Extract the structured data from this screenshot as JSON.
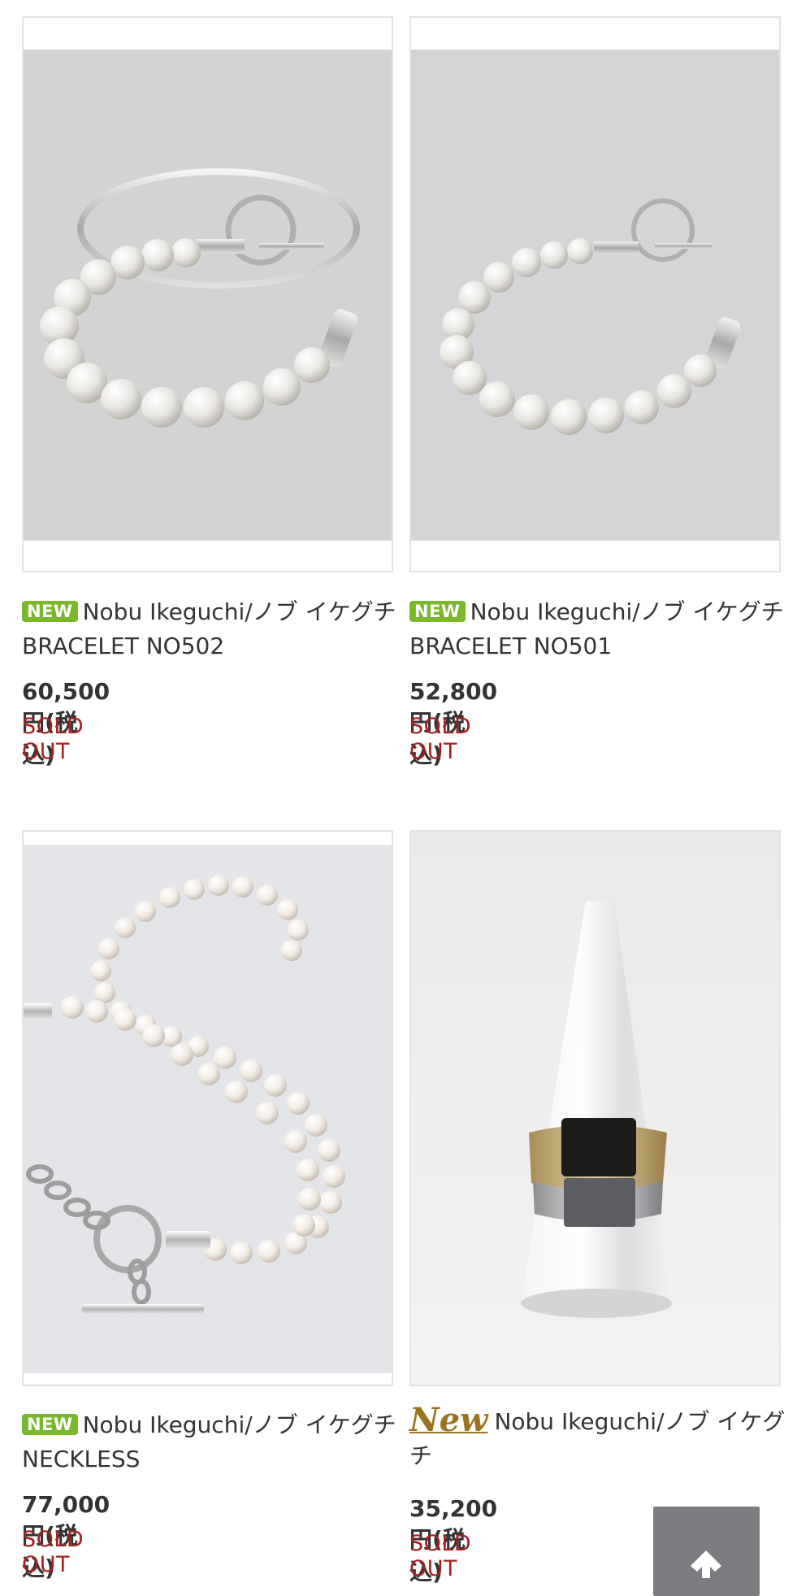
{
  "products": [
    {
      "badge": "NEW",
      "name": "Nobu Ikeguchi/ノブ イケグチ　BRACELET NO502",
      "price": "60,500円(税込)",
      "status": "SOLD OUT"
    },
    {
      "badge": "NEW",
      "name": "Nobu Ikeguchi/ノブ イケグチ　BRACELET NO501",
      "price": "52,800円(税込)",
      "status": "SOLD OUT"
    },
    {
      "badge": "NEW",
      "name": "Nobu Ikeguchi/ノブ イケグチ　NECKLESS",
      "price": "77,000円(税込)",
      "status": "SOLD OUT"
    },
    {
      "badge": "New",
      "name": "Nobu Ikeguchi/ノブ イケグチ",
      "price": "35,200円(税込)",
      "status": "SOLD OUT"
    }
  ],
  "colors": {
    "new_badge_green": "#7ab72a",
    "new_badge_gold": "#9a7420",
    "sold_out_red": "#a5211f",
    "scroll_top_bg": "#7b7c7f"
  },
  "icons": {
    "scroll_top": "arrow-up-icon"
  }
}
